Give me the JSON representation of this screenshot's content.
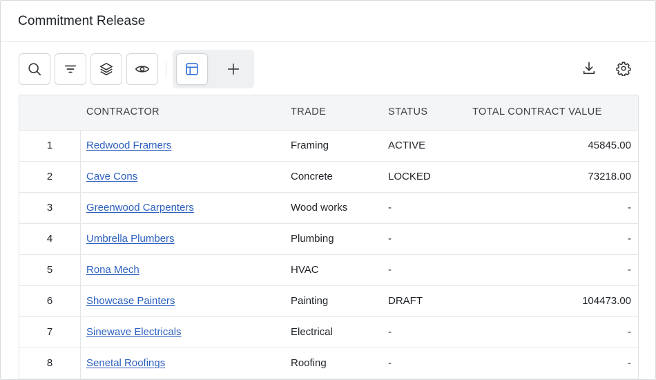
{
  "window": {
    "title": "Commitment Release"
  },
  "toolbar": {
    "buttons": [
      {
        "name": "search-button",
        "icon": "search-icon"
      },
      {
        "name": "filter-button",
        "icon": "filter-icon"
      },
      {
        "name": "layers-button",
        "icon": "layers-icon"
      },
      {
        "name": "visibility-button",
        "icon": "eye-icon"
      },
      {
        "name": "table-view-button",
        "icon": "table-icon",
        "active": true
      },
      {
        "name": "add-button",
        "icon": "plus-icon"
      },
      {
        "name": "download-button",
        "icon": "download-icon"
      },
      {
        "name": "settings-button",
        "icon": "gear-icon"
      }
    ],
    "accent_color": "#2b6fd6"
  },
  "table": {
    "columns": [
      "",
      "CONTRACTOR",
      "TRADE",
      "STATUS",
      "TOTAL CONTRACT VALUE"
    ],
    "link_color": "#2b5fbf",
    "rows": [
      {
        "index": "1",
        "contractor": "Redwood Framers",
        "trade": "Framing",
        "status": "ACTIVE",
        "value": "45845.00"
      },
      {
        "index": "2",
        "contractor": "Cave Cons",
        "trade": "Concrete",
        "status": "LOCKED",
        "value": "73218.00"
      },
      {
        "index": "3",
        "contractor": "Greenwood Carpenters",
        "trade": "Wood works",
        "status": "-",
        "value": "-"
      },
      {
        "index": "4",
        "contractor": "Umbrella Plumbers",
        "trade": "Plumbing",
        "status": "-",
        "value": "-"
      },
      {
        "index": "5",
        "contractor": "Rona Mech",
        "trade": "HVAC",
        "status": "-",
        "value": "-"
      },
      {
        "index": "6",
        "contractor": "Showcase Painters",
        "trade": "Painting",
        "status": "DRAFT",
        "value": "104473.00"
      },
      {
        "index": "7",
        "contractor": "Sinewave Electricals",
        "trade": "Electrical",
        "status": "-",
        "value": "-"
      },
      {
        "index": "8",
        "contractor": "Senetal Roofings",
        "trade": "Roofing",
        "status": "-",
        "value": "-"
      }
    ]
  }
}
